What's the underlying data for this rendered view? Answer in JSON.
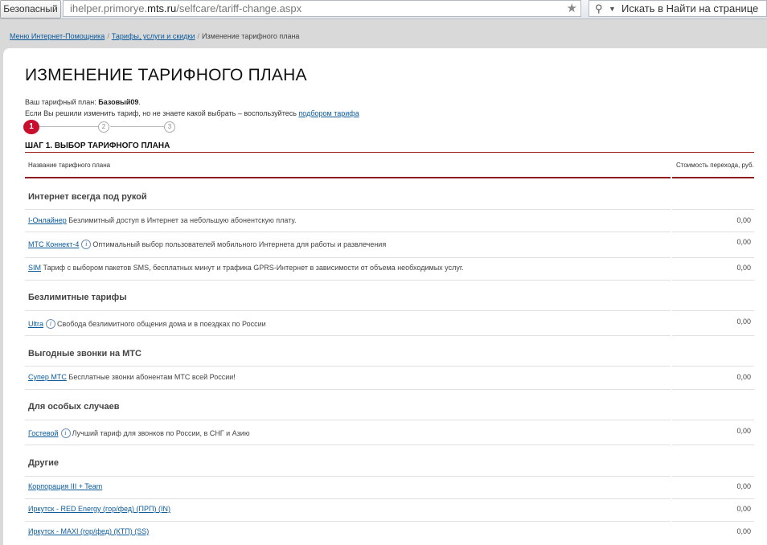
{
  "browser": {
    "security_label": "Безопасный",
    "url_prefix": "ihelper.primorye.",
    "url_host": "mts.ru",
    "url_path": "/selfcare/tariff-change.aspx",
    "search_placeholder": "Искать в Найти на странице"
  },
  "breadcrumb": {
    "items": [
      "Меню Интернет-Помощника",
      "Тарифы, услуги и скидки"
    ],
    "current": "Изменение тарифного плана",
    "separator": "/"
  },
  "page": {
    "title": "ИЗМЕНЕНИЕ ТАРИФНОГО ПЛАНА",
    "current_plan_label": "Ваш тарифный план:",
    "current_plan_value": "Базовый09",
    "hint_text": "Если Вы решили изменить тариф, но не знаете какой выбрать – воспользуйтесь",
    "hint_link": "подбором тарифа",
    "steps": [
      "1",
      "2",
      "3"
    ],
    "step_heading": "ШАГ 1. ВЫБОР ТАРИФНОГО ПЛАНА"
  },
  "table": {
    "col_name": "Название тарифного плана",
    "col_cost": "Стоимость перехода, руб.",
    "sections": [
      {
        "title": "Интернет всегда под рукой",
        "rows": [
          {
            "name": "I-Онлайнер",
            "info": false,
            "desc": "Безлимитный доступ в Интернет за небольшую абонентскую плату.",
            "cost": "0,00"
          },
          {
            "name": "МТС Коннект-4",
            "info": true,
            "desc": "Оптимальный выбор пользователей мобильного Интернета для работы и развлечения",
            "cost": "0,00"
          },
          {
            "name": "SIM",
            "info": false,
            "desc": "Тариф с выбором пакетов SMS, бесплатных минут и трафика GPRS-Интернет в зависимости от объема необходимых услуг.",
            "cost": "0,00"
          }
        ]
      },
      {
        "title": "Безлимитные тарифы",
        "rows": [
          {
            "name": "Ultra",
            "info": true,
            "desc": "Свобода безлимитного общения дома и в поездках по России",
            "cost": "0,00"
          }
        ]
      },
      {
        "title": "Выгодные звонки на МТС",
        "rows": [
          {
            "name": "Супер МТС",
            "info": false,
            "desc": "Бесплатные звонки абонентам МТС всей России!",
            "cost": "0,00"
          }
        ]
      },
      {
        "title": "Для особых случаев",
        "rows": [
          {
            "name": "Гостевой",
            "info": true,
            "desc": "Лучший тариф для звонков по России, в СНГ и Азию",
            "cost": "0,00"
          }
        ]
      },
      {
        "title": "Другие",
        "rows": [
          {
            "name": "Корпорация III + Team",
            "info": false,
            "desc": "",
            "cost": "0,00"
          },
          {
            "name": "Иркутск - RED Energy (гор/фед) (ПРП) (IN)",
            "info": false,
            "desc": "",
            "cost": "0,00"
          },
          {
            "name": "Иркутск - MAXI (гор/фед) (КТП) (SS)",
            "info": false,
            "desc": "",
            "cost": "0,00"
          }
        ]
      }
    ]
  },
  "colors": {
    "accent": "#c8102e",
    "link": "#0a5a9c",
    "rule": "#8f1d1d"
  }
}
